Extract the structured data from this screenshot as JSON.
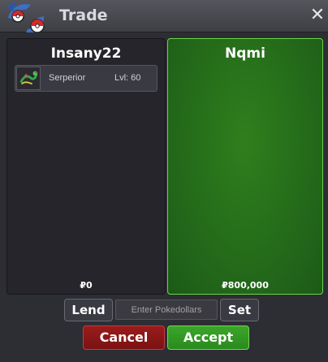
{
  "window": {
    "title": "Trade",
    "close_glyph": "✕"
  },
  "left_panel": {
    "player_name": "Insany22",
    "money": "₽0",
    "items": [
      {
        "name": "Serperior",
        "level": "Lvl: 60",
        "icon": "serperior-sprite-icon"
      }
    ]
  },
  "right_panel": {
    "player_name": "Nqmi",
    "money": "₽800,000",
    "status_color": "#2f7f1c"
  },
  "controls": {
    "lend_label": "Lend",
    "pokedollar_placeholder": "Enter Pokedollars",
    "set_label": "Set",
    "cancel_label": "Cancel",
    "accept_label": "Accept"
  },
  "colors": {
    "accept_green": "#3ca52a",
    "cancel_red": "#9a1c1c",
    "panel_dark": "#25252b"
  }
}
